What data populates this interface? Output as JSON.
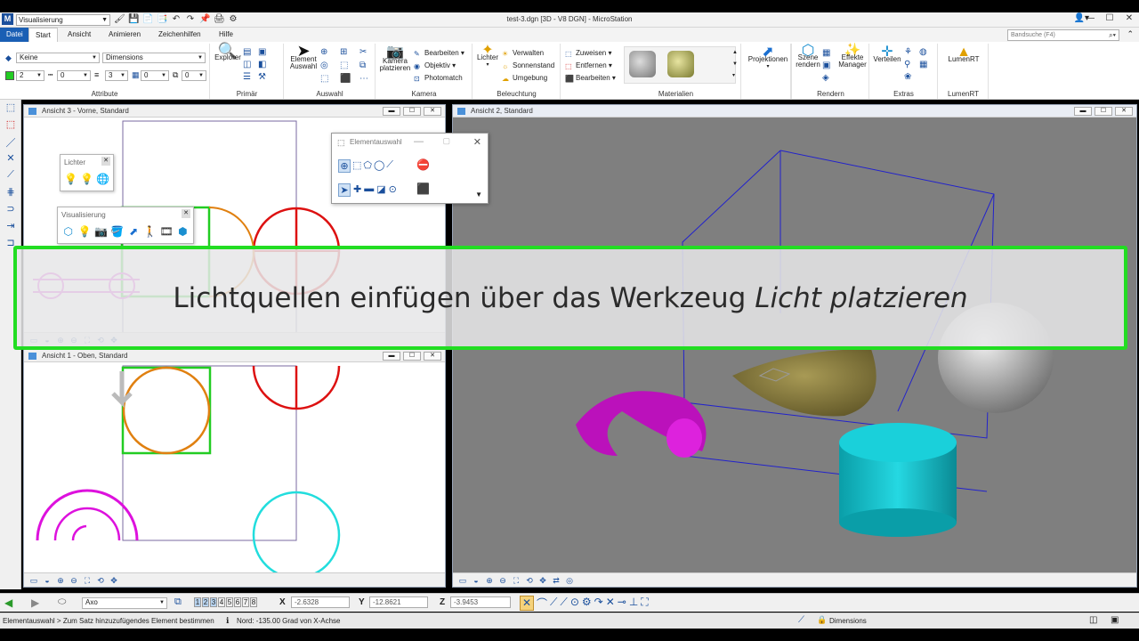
{
  "app": {
    "title": "test-3.dgn [3D - V8 DGN] - MicroStation",
    "workspace": "Visualisierung",
    "logo": "M"
  },
  "tabs": [
    "Datei",
    "Start",
    "Ansicht",
    "Animieren",
    "Zeichenhilfen",
    "Hilfe"
  ],
  "search_placeholder": "Bandsuche (F4)",
  "ribbon": {
    "attributes": {
      "level": "Keine",
      "text_style": "Dimensions",
      "color": "2",
      "style": "0",
      "weight": "3",
      "transparency": "0",
      "priority": "0",
      "label": "Attribute"
    },
    "primary": {
      "explorer": "Explorer",
      "label": "Primär"
    },
    "selection": {
      "element_select": "Element Auswahl",
      "label": "Auswahl"
    },
    "camera": {
      "place": "Kamera platzieren",
      "items": [
        "Bearbeiten",
        "Objektiv",
        "Photomatch"
      ],
      "label": "Kamera"
    },
    "lighting": {
      "lights": "Lichter",
      "items": [
        "Verwalten",
        "Sonnenstand",
        "Umgebung"
      ],
      "label": "Beleuchtung"
    },
    "materials": {
      "items": [
        "Zuweisen",
        "Entfernen",
        "Bearbeiten"
      ],
      "label": "Materialien"
    },
    "projections": {
      "label_btn": "Projektionen"
    },
    "render": {
      "scene": "Szene rendern",
      "effects": "Effekte Manager",
      "label": "Rendern"
    },
    "extras": {
      "distribute": "Verteilen",
      "label": "Extras"
    },
    "lumenrt": {
      "btn": "LumenRT",
      "label": "LumenRT"
    }
  },
  "views": {
    "front": "Ansicht 3 - Vorne, Standard",
    "top": "Ansicht 1 - Oben, Standard",
    "iso": "Ansicht 2, Standard"
  },
  "panels": {
    "lights": "Lichter",
    "visualization": "Visualisierung",
    "element_selection": "Elementauswahl"
  },
  "banner": {
    "text": "Lichtquellen einfügen über das Werkzeug ",
    "tool": "Licht platzieren"
  },
  "status": {
    "view_mode": "Axo",
    "x_label": "X",
    "x": "-2.6328",
    "y_label": "Y",
    "y": "-12.8621",
    "z_label": "Z",
    "z": "-3.9453",
    "view_numbers": [
      "1",
      "2",
      "3",
      "4",
      "5",
      "6",
      "7",
      "8"
    ],
    "prompt": "Elementauswahl > Zum Satz hinzuzufügendes Element bestimmen",
    "direction": "Nord: -135.00 Grad von X-Achse",
    "level": "Dimensions"
  }
}
